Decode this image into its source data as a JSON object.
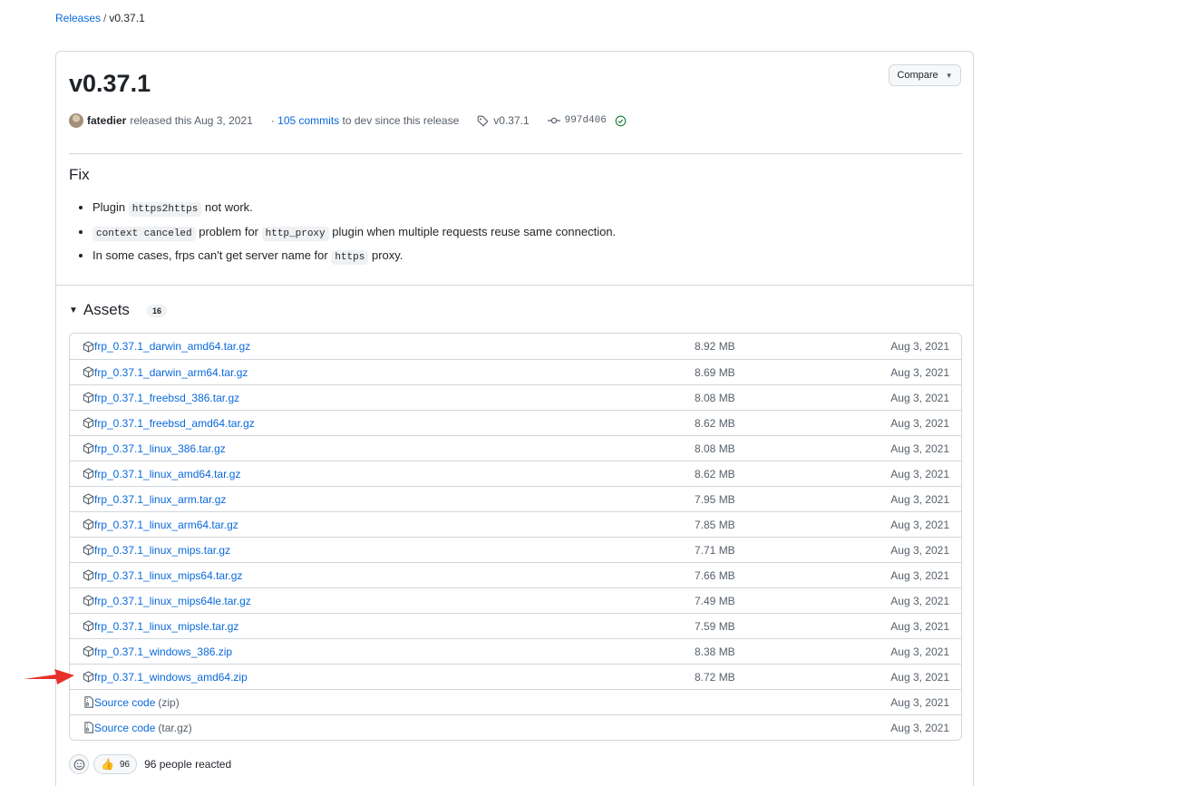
{
  "breadcrumb": {
    "parent": "Releases",
    "separator": "/",
    "current": "v0.37.1"
  },
  "release": {
    "title": "v0.37.1",
    "compare_label": "Compare",
    "author": "fatedier",
    "released_text": "released this Aug 3, 2021",
    "commits_prefix": "·",
    "commits_link": "105 commits",
    "commits_suffix": "to dev since this release",
    "tag": "v0.37.1",
    "commit_sha": "997d406"
  },
  "notes": {
    "heading": "Fix",
    "items": [
      {
        "pre": "Plugin",
        "code": "https2https",
        "post": "not work."
      },
      {
        "code": "context canceled",
        "mid": "problem for",
        "code2": "http_proxy",
        "post": "plugin when multiple requests reuse same connection."
      },
      {
        "pre": "In some cases, frps can't get server name for",
        "code": "https",
        "post": "proxy."
      }
    ]
  },
  "assets": {
    "label": "Assets",
    "count": "16",
    "rows": [
      {
        "icon": "package-icon",
        "name": "frp_0.37.1_darwin_amd64.tar.gz",
        "size": "8.92 MB",
        "date": "Aug 3, 2021"
      },
      {
        "icon": "package-icon",
        "name": "frp_0.37.1_darwin_arm64.tar.gz",
        "size": "8.69 MB",
        "date": "Aug 3, 2021"
      },
      {
        "icon": "package-icon",
        "name": "frp_0.37.1_freebsd_386.tar.gz",
        "size": "8.08 MB",
        "date": "Aug 3, 2021"
      },
      {
        "icon": "package-icon",
        "name": "frp_0.37.1_freebsd_amd64.tar.gz",
        "size": "8.62 MB",
        "date": "Aug 3, 2021"
      },
      {
        "icon": "package-icon",
        "name": "frp_0.37.1_linux_386.tar.gz",
        "size": "8.08 MB",
        "date": "Aug 3, 2021"
      },
      {
        "icon": "package-icon",
        "name": "frp_0.37.1_linux_amd64.tar.gz",
        "size": "8.62 MB",
        "date": "Aug 3, 2021"
      },
      {
        "icon": "package-icon",
        "name": "frp_0.37.1_linux_arm.tar.gz",
        "size": "7.95 MB",
        "date": "Aug 3, 2021"
      },
      {
        "icon": "package-icon",
        "name": "frp_0.37.1_linux_arm64.tar.gz",
        "size": "7.85 MB",
        "date": "Aug 3, 2021"
      },
      {
        "icon": "package-icon",
        "name": "frp_0.37.1_linux_mips.tar.gz",
        "size": "7.71 MB",
        "date": "Aug 3, 2021"
      },
      {
        "icon": "package-icon",
        "name": "frp_0.37.1_linux_mips64.tar.gz",
        "size": "7.66 MB",
        "date": "Aug 3, 2021"
      },
      {
        "icon": "package-icon",
        "name": "frp_0.37.1_linux_mips64le.tar.gz",
        "size": "7.49 MB",
        "date": "Aug 3, 2021"
      },
      {
        "icon": "package-icon",
        "name": "frp_0.37.1_linux_mipsle.tar.gz",
        "size": "7.59 MB",
        "date": "Aug 3, 2021"
      },
      {
        "icon": "package-icon",
        "name": "frp_0.37.1_windows_386.zip",
        "size": "8.38 MB",
        "date": "Aug 3, 2021"
      },
      {
        "icon": "package-icon",
        "name": "frp_0.37.1_windows_amd64.zip",
        "size": "8.72 MB",
        "date": "Aug 3, 2021"
      },
      {
        "icon": "file-zip-icon",
        "name": "Source code",
        "paren": "(zip)",
        "size": "",
        "date": "Aug 3, 2021"
      },
      {
        "icon": "file-zip-icon",
        "name": "Source code",
        "paren": "(tar.gz)",
        "size": "",
        "date": "Aug 3, 2021"
      }
    ]
  },
  "reactions": {
    "thumbs_count": "96",
    "label": "96 people reacted"
  },
  "annotation": {
    "arrow_color": "#e8302a"
  }
}
